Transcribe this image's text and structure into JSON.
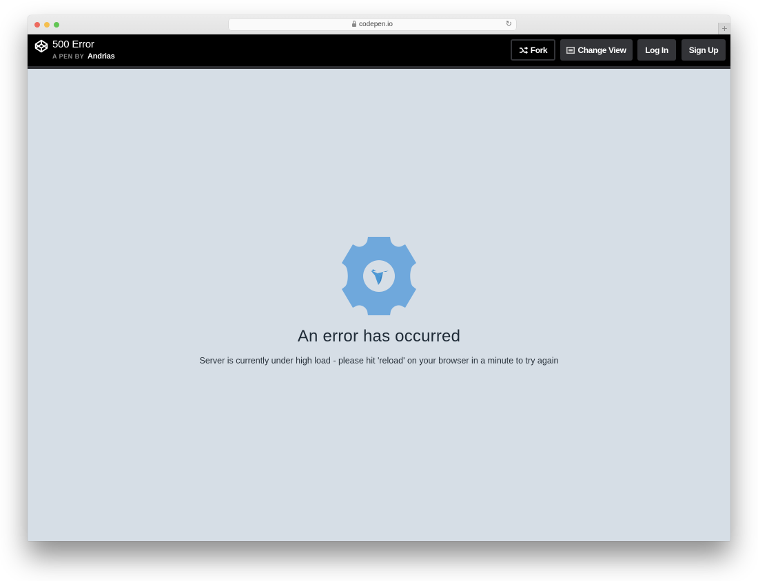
{
  "browser": {
    "url": "codepen.io",
    "reload_icon": "reload-icon",
    "new_tab_label": "+"
  },
  "header": {
    "pen_title": "500 Error",
    "pen_by_label": "A PEN BY",
    "author": "Andrias",
    "logo_icon": "codepen-logo-icon",
    "buttons": {
      "fork": "Fork",
      "change_view": "Change View",
      "log_in": "Log In",
      "sign_up": "Sign Up"
    }
  },
  "content": {
    "icon": "gear-hummingbird-icon",
    "title": "An error has occurred",
    "message": "Server is currently under high load - please hit 'reload' on your browser in a minute to try again",
    "accent_color": "#6fa8dc"
  }
}
